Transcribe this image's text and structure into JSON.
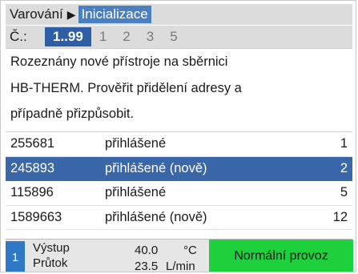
{
  "breadcrumb": {
    "parent": "Varování",
    "separator": "▶",
    "current": "Inicializace"
  },
  "range_tabs": {
    "prefix": "Č.:",
    "items": [
      "1..99",
      "1",
      "2",
      "3",
      "5"
    ],
    "selected_index": 0
  },
  "message": {
    "lines": [
      "Rozeznány nové přístroje na sběrnici",
      "HB-THERM. Prověřit přidělení adresy a",
      "případně přizpůsobit."
    ]
  },
  "devices": [
    {
      "id": "255681",
      "status": "přihlášené",
      "address": "1",
      "selected": false
    },
    {
      "id": "245893",
      "status": "přihlášené (nově)",
      "address": "2",
      "selected": true
    },
    {
      "id": "115896",
      "status": "přihlášené",
      "address": "5",
      "selected": false
    },
    {
      "id": "1589663",
      "status": "přihlášené (nově)",
      "address": "12",
      "selected": false
    }
  ],
  "statusbar": {
    "unit": "1",
    "label_output": "Výstup",
    "label_flow": "Průtok",
    "output_value": "40.0",
    "output_unit": "°C",
    "flow_value": "23.5",
    "flow_unit": "L/min",
    "mode": "Normální provoz",
    "mode_color": "#1ed13c"
  },
  "colors": {
    "accent": "#2d5ea6",
    "selected_row": "#3a66aa",
    "breadcrumb_active": "#4a7fc1"
  }
}
